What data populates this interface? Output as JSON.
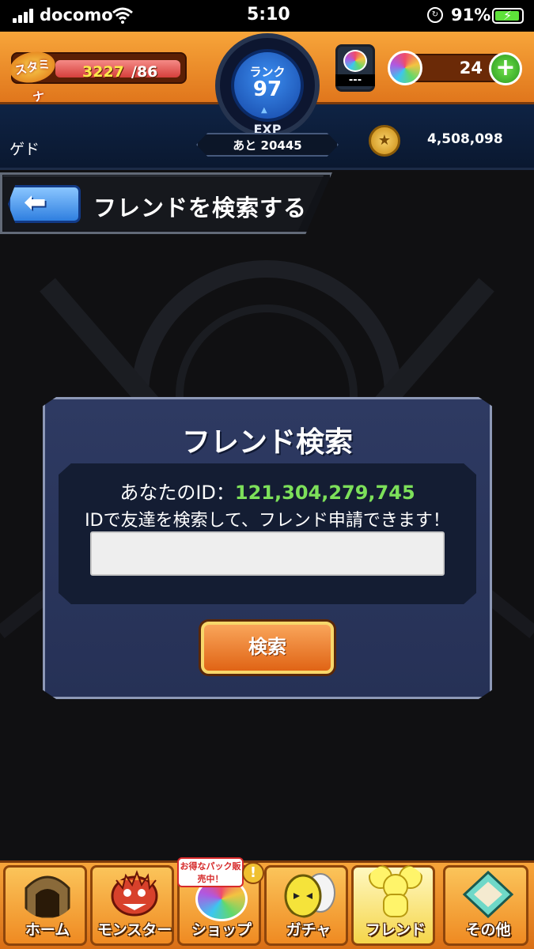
{
  "status_bar": {
    "carrier": "docomo",
    "time": "5:10",
    "battery_percent": "91%"
  },
  "hud": {
    "stamina_label": "スタミナ",
    "stamina_current": "3227",
    "stamina_max": "/86",
    "rank_label": "ランク",
    "rank_value": "97",
    "exp_label": "EXP",
    "exp_remaining": "あと 20445",
    "orb_item_value": "---",
    "orb_count": "24",
    "player_name": "ゲド",
    "coins": "4,508,098"
  },
  "header": {
    "title": "フレンドを検索する"
  },
  "dialog": {
    "title": "フレンド検索",
    "id_label": "あなたのID：",
    "id_value": "121,304,279,745",
    "description": "IDで友達を検索して、フレンド申請できます！",
    "input_value": "",
    "input_placeholder": "",
    "search_button": "検索"
  },
  "bottom_nav": {
    "items": [
      {
        "label": "ホーム",
        "icon": "gate-icon"
      },
      {
        "label": "モンスター",
        "icon": "dragon-icon"
      },
      {
        "label": "ショップ",
        "icon": "rainbow-orb-icon"
      },
      {
        "label": "ガチャ",
        "icon": "egg-icon"
      },
      {
        "label": "フレンド",
        "icon": "friends-icon"
      },
      {
        "label": "その他",
        "icon": "diamond-icon"
      }
    ],
    "shop_badge": "お得なパック販売中！",
    "shop_alert": "!"
  },
  "colors": {
    "hud_orange": "#f7a53a",
    "hud_blue": "#0f2344",
    "id_green": "#7de05a",
    "dialog_bg": "#2e3a62",
    "button_orange": "#e06415"
  }
}
